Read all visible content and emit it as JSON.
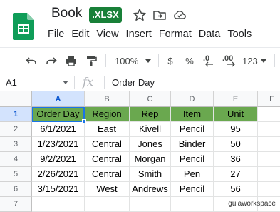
{
  "app": {
    "doc_title": "Book",
    "file_badge": ".XLSX",
    "menu": [
      "File",
      "Edit",
      "View",
      "Insert",
      "Format",
      "Data",
      "Tools"
    ]
  },
  "toolbar": {
    "zoom": "100%",
    "currency": "$",
    "percent": "%",
    "decrease_decimals": ".0",
    "increase_decimals": ".00",
    "number_format": "123"
  },
  "formula_bar": {
    "cell_ref": "A1",
    "fx": "fx",
    "content": "Order Day"
  },
  "grid": {
    "columns": [
      "A",
      "B",
      "C",
      "D",
      "E",
      "F"
    ],
    "rows": [
      "1",
      "2",
      "3",
      "4",
      "5",
      "6",
      "7"
    ],
    "header_fill": "#6aa84f",
    "data": [
      [
        "Order Day",
        "Region",
        "Rep",
        "Item",
        "Unit"
      ],
      [
        "6/1/2021",
        "East",
        "Kivell",
        "Pencil",
        "95"
      ],
      [
        "1/23/2021",
        "Central",
        "Jones",
        "Binder",
        "50"
      ],
      [
        "9/2/2021",
        "Central",
        "Morgan",
        "Pencil",
        "36"
      ],
      [
        "2/26/2021",
        "Central",
        "Smith",
        "Pen",
        "27"
      ],
      [
        "3/15/2021",
        "West",
        "Andrews",
        "Pencil",
        "56"
      ]
    ]
  },
  "watermark": "guiaworkspace"
}
